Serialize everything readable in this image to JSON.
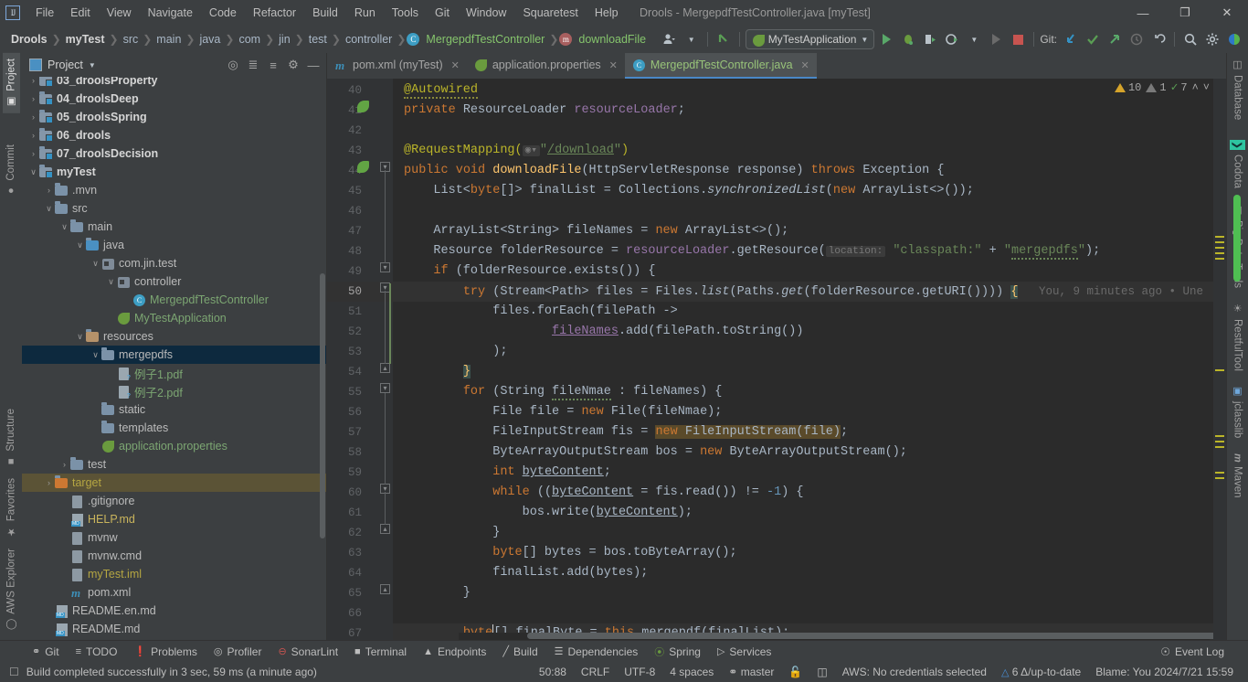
{
  "window": {
    "title": "Drools - MergepdfTestController.java [myTest]",
    "logo": "IJ",
    "controls": {
      "minimize": "—",
      "maximize": "❐",
      "close": "✕"
    }
  },
  "menu": [
    {
      "label": "File"
    },
    {
      "label": "Edit"
    },
    {
      "label": "View"
    },
    {
      "label": "Navigate"
    },
    {
      "label": "Code"
    },
    {
      "label": "Refactor"
    },
    {
      "label": "Build"
    },
    {
      "label": "Run"
    },
    {
      "label": "Tools"
    },
    {
      "label": "Git"
    },
    {
      "label": "Window"
    },
    {
      "label": "Squaretest"
    },
    {
      "label": "Help"
    }
  ],
  "breadcrumbs": [
    {
      "label": "Drools",
      "style": "bold"
    },
    {
      "label": "myTest",
      "style": "bold"
    },
    {
      "label": "src",
      "style": "plain"
    },
    {
      "label": "main",
      "style": "plain"
    },
    {
      "label": "java",
      "style": "plain"
    },
    {
      "label": "com",
      "style": "plain"
    },
    {
      "label": "jin",
      "style": "plain"
    },
    {
      "label": "test",
      "style": "plain"
    },
    {
      "label": "controller",
      "style": "plain"
    },
    {
      "label": "MergepdfTestController",
      "style": "class"
    },
    {
      "label": "downloadFile",
      "style": "method"
    }
  ],
  "toolbar": {
    "run_config": "MyTestApplication",
    "git_label": "Git:",
    "icons": {
      "user": "user-avatar-icon",
      "back": "back-arrow-icon",
      "run": "run-icon",
      "debug": "debug-icon",
      "run_coverage": "run-with-coverage-icon",
      "profile": "profile-icon",
      "rerun_dim": "rerun-disabled-icon",
      "stop": "stop-icon",
      "update": "git-update-icon",
      "commit": "git-commit-icon",
      "push": "git-push-icon",
      "history": "git-history-icon",
      "rollback": "git-rollback-icon",
      "search": "search-everywhere-icon",
      "settings": "settings-gear-icon",
      "theme": "theme-icon"
    }
  },
  "project_panel": {
    "title": "Project",
    "tools": [
      "locate-icon",
      "expand-all-icon",
      "collapse-all-icon",
      "settings-icon",
      "hide-icon"
    ],
    "tree": [
      {
        "label": "03_droolsProperty",
        "indent": 1,
        "arrow": "›",
        "icon": "module-folder",
        "style": "bold",
        "clipped": true
      },
      {
        "label": "04_droolsDeep",
        "indent": 1,
        "arrow": "›",
        "icon": "module-folder",
        "style": "bold"
      },
      {
        "label": "05_droolsSpring",
        "indent": 1,
        "arrow": "›",
        "icon": "module-folder",
        "style": "bold"
      },
      {
        "label": "06_drools",
        "indent": 1,
        "arrow": "›",
        "icon": "module-folder",
        "style": "bold"
      },
      {
        "label": "07_droolsDecision",
        "indent": 1,
        "arrow": "›",
        "icon": "module-folder",
        "style": "bold"
      },
      {
        "label": "myTest",
        "indent": 1,
        "arrow": "∨",
        "icon": "module-folder",
        "style": "bold"
      },
      {
        "label": ".mvn",
        "indent": 2,
        "arrow": "›",
        "icon": "folder",
        "style": "plain"
      },
      {
        "label": "src",
        "indent": 2,
        "arrow": "∨",
        "icon": "folder",
        "style": "plain"
      },
      {
        "label": "main",
        "indent": 3,
        "arrow": "∨",
        "icon": "folder",
        "style": "plain"
      },
      {
        "label": "java",
        "indent": 4,
        "arrow": "∨",
        "icon": "source-folder",
        "style": "plain"
      },
      {
        "label": "com.jin.test",
        "indent": 5,
        "arrow": "∨",
        "icon": "package",
        "style": "plain"
      },
      {
        "label": "controller",
        "indent": 6,
        "arrow": "∨",
        "icon": "package",
        "style": "plain"
      },
      {
        "label": "MergepdfTestController",
        "indent": 7,
        "arrow": "",
        "icon": "java-class",
        "style": "green"
      },
      {
        "label": "MyTestApplication",
        "indent": 6,
        "arrow": "",
        "icon": "spring-class",
        "style": "green"
      },
      {
        "label": "resources",
        "indent": 4,
        "arrow": "∨",
        "icon": "resource-folder",
        "style": "plain"
      },
      {
        "label": "mergepdfs",
        "indent": 5,
        "arrow": "∨",
        "icon": "folder",
        "style": "plain",
        "selected": true
      },
      {
        "label": "例子1.pdf",
        "indent": 6,
        "arrow": "",
        "icon": "pdf-file",
        "style": "green"
      },
      {
        "label": "例子2.pdf",
        "indent": 6,
        "arrow": "",
        "icon": "pdf-file",
        "style": "green"
      },
      {
        "label": "static",
        "indent": 5,
        "arrow": "",
        "icon": "folder",
        "style": "plain"
      },
      {
        "label": "templates",
        "indent": 5,
        "arrow": "",
        "icon": "folder",
        "style": "plain"
      },
      {
        "label": "application.properties",
        "indent": 5,
        "arrow": "",
        "icon": "spring-properties",
        "style": "green"
      },
      {
        "label": "test",
        "indent": 3,
        "arrow": "›",
        "icon": "folder",
        "style": "plain"
      },
      {
        "label": "target",
        "indent": 2,
        "arrow": "›",
        "icon": "target-folder",
        "style": "olive",
        "highlighted": true
      },
      {
        "label": ".gitignore",
        "indent": 3,
        "arrow": "",
        "icon": "gitignore-file",
        "style": "plain"
      },
      {
        "label": "HELP.md",
        "indent": 3,
        "arrow": "",
        "icon": "markdown-file",
        "style": "yellow"
      },
      {
        "label": "mvnw",
        "indent": 3,
        "arrow": "",
        "icon": "script-file",
        "style": "plain"
      },
      {
        "label": "mvnw.cmd",
        "indent": 3,
        "arrow": "",
        "icon": "text-file",
        "style": "plain"
      },
      {
        "label": "myTest.iml",
        "indent": 3,
        "arrow": "",
        "icon": "iml-file",
        "style": "olive"
      },
      {
        "label": "pom.xml",
        "indent": 3,
        "arrow": "",
        "icon": "maven-file",
        "style": "plain"
      },
      {
        "label": "README.en.md",
        "indent": 2,
        "arrow": "",
        "icon": "markdown-file",
        "style": "plain"
      },
      {
        "label": "README.md",
        "indent": 2,
        "arrow": "",
        "icon": "markdown-file",
        "style": "plain"
      }
    ]
  },
  "left_stripe": [
    {
      "label": "Project",
      "icon": "project-icon",
      "selected": true
    },
    {
      "label": "Commit",
      "icon": "commit-icon",
      "selected": false
    },
    {
      "label": "Structure",
      "icon": "structure-icon",
      "selected": false
    },
    {
      "label": "Favorites",
      "icon": "star-icon",
      "selected": false
    },
    {
      "label": "AWS Explorer",
      "icon": "aws-icon",
      "selected": false
    }
  ],
  "right_stripe": [
    {
      "label": "Database",
      "icon": "database-icon"
    },
    {
      "label": "Codota",
      "icon": "codota-icon"
    },
    {
      "label": "Big Data Tools",
      "icon": "bigdata-icon"
    },
    {
      "label": "RestfulTool",
      "icon": "restful-icon"
    },
    {
      "label": "jclasslib",
      "icon": "jclasslib-icon"
    },
    {
      "label": "Maven",
      "icon": "maven-icon"
    }
  ],
  "editor_tabs": [
    {
      "label": "pom.xml (myTest)",
      "icon": "maven-file",
      "active": false,
      "close": "✕"
    },
    {
      "label": "application.properties",
      "icon": "spring-properties",
      "active": false,
      "close": "✕"
    },
    {
      "label": "MergepdfTestController.java",
      "icon": "java-class",
      "active": true,
      "close": "✕"
    }
  ],
  "inspections": {
    "warnings": "10",
    "weak_warnings": "1",
    "typos": "7",
    "up_arrow": "˄",
    "down_arrow": "˅"
  },
  "code": {
    "first_line": 40,
    "current_line": 50,
    "blame_hint": "You, 9 minutes ago • Une",
    "param_hint": "location:",
    "lines": [
      {
        "n": 40,
        "text": "@Autowired"
      },
      {
        "n": 41,
        "text": "private ResourceLoader resourceLoader;"
      },
      {
        "n": 42,
        "text": ""
      },
      {
        "n": 43,
        "text": "@RequestMapping(\"/download\")"
      },
      {
        "n": 44,
        "text": "public void downloadFile(HttpServletResponse response) throws Exception {"
      },
      {
        "n": 45,
        "text": "    List<byte[]> finalList = Collections.synchronizedList(new ArrayList<>());"
      },
      {
        "n": 46,
        "text": ""
      },
      {
        "n": 47,
        "text": "    ArrayList<String> fileNames = new ArrayList<>();"
      },
      {
        "n": 48,
        "text": "    Resource folderResource = resourceLoader.getResource(\"classpath:\" + \"mergepdfs\");"
      },
      {
        "n": 49,
        "text": "    if (folderResource.exists()) {"
      },
      {
        "n": 50,
        "text": "        try (Stream<Path> files = Files.list(Paths.get(folderResource.getURI()))) {"
      },
      {
        "n": 51,
        "text": "            files.forEach(filePath ->"
      },
      {
        "n": 52,
        "text": "                    fileNames.add(filePath.toString())"
      },
      {
        "n": 53,
        "text": "            );"
      },
      {
        "n": 54,
        "text": "        }"
      },
      {
        "n": 55,
        "text": "        for (String fileNmae : fileNames) {"
      },
      {
        "n": 56,
        "text": "            File file = new File(fileNmae);"
      },
      {
        "n": 57,
        "text": "            FileInputStream fis = new FileInputStream(file);"
      },
      {
        "n": 58,
        "text": "            ByteArrayOutputStream bos = new ByteArrayOutputStream();"
      },
      {
        "n": 59,
        "text": "            int byteContent;"
      },
      {
        "n": 60,
        "text": "            while ((byteContent = fis.read()) != -1) {"
      },
      {
        "n": 61,
        "text": "                bos.write(byteContent);"
      },
      {
        "n": 62,
        "text": "            }"
      },
      {
        "n": 63,
        "text": "            byte[] bytes = bos.toByteArray();"
      },
      {
        "n": 64,
        "text": "            finalList.add(bytes);"
      },
      {
        "n": 65,
        "text": "        }"
      },
      {
        "n": 66,
        "text": ""
      },
      {
        "n": 67,
        "text": "        byte[] finalByte = this.mergepdf(finalList);"
      }
    ]
  },
  "bottom_tabs": [
    {
      "label": "Git",
      "icon": "git-branch-icon"
    },
    {
      "label": "TODO",
      "icon": "todo-list-icon"
    },
    {
      "label": "Problems",
      "icon": "problems-icon"
    },
    {
      "label": "Profiler",
      "icon": "profiler-icon"
    },
    {
      "label": "SonarLint",
      "icon": "sonarlint-icon"
    },
    {
      "label": "Terminal",
      "icon": "terminal-icon"
    },
    {
      "label": "Endpoints",
      "icon": "endpoints-icon"
    },
    {
      "label": "Build",
      "icon": "build-hammer-icon"
    },
    {
      "label": "Dependencies",
      "icon": "dependencies-icon"
    },
    {
      "label": "Spring",
      "icon": "spring-leaf-icon"
    },
    {
      "label": "Services",
      "icon": "services-icon"
    }
  ],
  "event_log": {
    "label": "Event Log",
    "icon": "event-log-icon"
  },
  "status": {
    "message": "Build completed successfully in 3 sec, 59 ms (a minute ago)",
    "message_icon": "console-icon",
    "caret_position": "50:88",
    "line_separator": "CRLF",
    "encoding": "UTF-8",
    "indent": "4 spaces",
    "branch": "master",
    "lock_icon": "read-only-lock-icon",
    "db_icon": "database-status-icon",
    "aws": "AWS: No credentials selected",
    "sonar": "6 Δ/up-to-date",
    "blame": "Blame: You 2024/7/21 15:59"
  },
  "colors": {
    "background": "#3c3f41",
    "editor_bg": "#2b2b2b",
    "accent_blue": "#4a88c7",
    "selection": "#0d293e",
    "string_green": "#6a8759",
    "keyword_orange": "#cc7832",
    "annotation_yellow": "#bbb529",
    "method_yellow": "#ffc66d",
    "field_purple": "#9876aa",
    "number_blue": "#6897bb"
  }
}
